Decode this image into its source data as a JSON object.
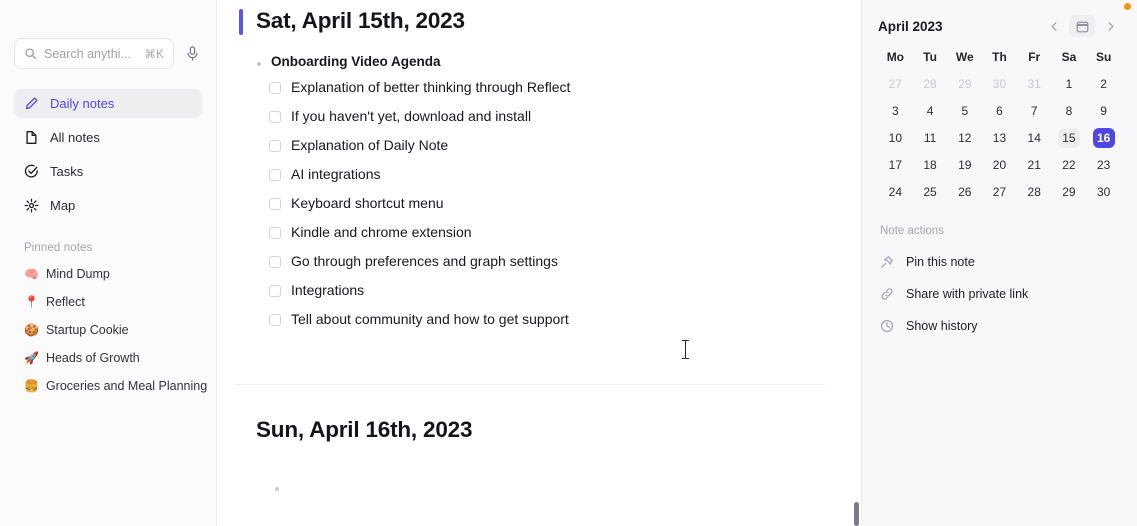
{
  "sidebar": {
    "search": {
      "placeholder": "Search anythi...",
      "shortcut": "⌘K"
    },
    "nav": [
      {
        "label": "Daily notes",
        "icon": "pencil-icon",
        "active": true
      },
      {
        "label": "All notes",
        "icon": "document-icon",
        "active": false
      },
      {
        "label": "Tasks",
        "icon": "check-circle-icon",
        "active": false
      },
      {
        "label": "Map",
        "icon": "asterisk-icon",
        "active": false
      }
    ],
    "pinned_label": "Pinned notes",
    "pinned": [
      {
        "emoji": "🧠",
        "label": "Mind Dump"
      },
      {
        "emoji": "📍",
        "label": "Reflect"
      },
      {
        "emoji": "🍪",
        "label": "Startup Cookie"
      },
      {
        "emoji": "🚀",
        "label": "Heads of Growth"
      },
      {
        "emoji": "🍔",
        "label": "Groceries and Meal Planning"
      }
    ]
  },
  "main": {
    "day_one": {
      "title": "Sat, April 15th, 2023",
      "agenda_heading": "Onboarding Video Agenda",
      "items": [
        "Explanation of better thinking through Reflect",
        "If you haven't yet, download and install",
        "Explanation of Daily Note",
        "AI integrations",
        "Keyboard shortcut menu",
        "Kindle and chrome extension",
        "Go through preferences and graph settings",
        "Integrations",
        "Tell about community and how to get support"
      ]
    },
    "day_two": {
      "title": "Sun, April 16th, 2023"
    }
  },
  "calendar": {
    "month": "April 2023",
    "dow": [
      "Mo",
      "Tu",
      "We",
      "Th",
      "Fr",
      "Sa",
      "Su"
    ],
    "weeks": [
      [
        {
          "n": "27",
          "state": "muted"
        },
        {
          "n": "28",
          "state": "muted"
        },
        {
          "n": "29",
          "state": "muted"
        },
        {
          "n": "30",
          "state": "muted"
        },
        {
          "n": "31",
          "state": "muted"
        },
        {
          "n": "1",
          "state": ""
        },
        {
          "n": "2",
          "state": ""
        }
      ],
      [
        {
          "n": "3",
          "state": ""
        },
        {
          "n": "4",
          "state": ""
        },
        {
          "n": "5",
          "state": ""
        },
        {
          "n": "6",
          "state": ""
        },
        {
          "n": "7",
          "state": ""
        },
        {
          "n": "8",
          "state": ""
        },
        {
          "n": "9",
          "state": ""
        }
      ],
      [
        {
          "n": "10",
          "state": ""
        },
        {
          "n": "11",
          "state": ""
        },
        {
          "n": "12",
          "state": ""
        },
        {
          "n": "13",
          "state": ""
        },
        {
          "n": "14",
          "state": ""
        },
        {
          "n": "15",
          "state": "soft"
        },
        {
          "n": "16",
          "state": "sel"
        }
      ],
      [
        {
          "n": "17",
          "state": ""
        },
        {
          "n": "18",
          "state": ""
        },
        {
          "n": "19",
          "state": ""
        },
        {
          "n": "20",
          "state": ""
        },
        {
          "n": "21",
          "state": ""
        },
        {
          "n": "22",
          "state": ""
        },
        {
          "n": "23",
          "state": ""
        }
      ],
      [
        {
          "n": "24",
          "state": ""
        },
        {
          "n": "25",
          "state": ""
        },
        {
          "n": "26",
          "state": ""
        },
        {
          "n": "27",
          "state": ""
        },
        {
          "n": "28",
          "state": ""
        },
        {
          "n": "29",
          "state": ""
        },
        {
          "n": "30",
          "state": ""
        }
      ]
    ],
    "selected_day": "16",
    "today_day": "15"
  },
  "note_actions": {
    "label": "Note actions",
    "items": [
      {
        "label": "Pin this note",
        "icon": "pin-icon"
      },
      {
        "label": "Share with private link",
        "icon": "link-icon"
      },
      {
        "label": "Show history",
        "icon": "clock-icon"
      }
    ]
  },
  "colors": {
    "accent": "#4f46e5",
    "accent_bar": "#5b55e0",
    "notification_dot": "#f0950f"
  }
}
